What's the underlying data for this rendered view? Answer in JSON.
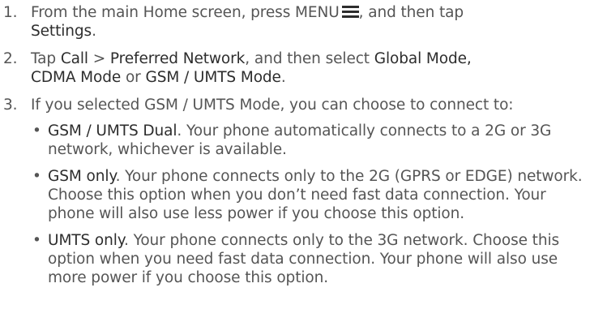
{
  "steps": [
    {
      "number": "1.",
      "part1": "From the main Home screen, press MENU",
      "icon": "menu-icon",
      "part2": ", and then tap",
      "settings": "Settings",
      "part3": "."
    },
    {
      "number": "2.",
      "part1": "Tap",
      "call": "Call",
      "sep": ">",
      "preferred": "Preferred Network",
      "part2": ", and then select",
      "global": "Global Mode,",
      "cdma": "CDMA Mode",
      "or": "or",
      "gsm_umts": "GSM / UMTS Mode",
      "part3": "."
    },
    {
      "number": "3.",
      "text": "If you selected GSM / UMTS Mode, you can choose to connect to:",
      "bullets": [
        {
          "title": "GSM / UMTS Dual",
          "text": ". Your phone automatically connects to a 2G or 3G network, whichever is available."
        },
        {
          "title": "GSM only",
          "text": ". Your phone connects only to the 2G (GPRS or EDGE) network. Choose this option when you don’t need fast data connection. Your phone will also use less power if you choose this option."
        },
        {
          "title": "UMTS only",
          "text": ". Your phone connects only to the 3G network. Choose this option when you need fast data connection. Your phone will also use more power if you choose this option."
        }
      ]
    }
  ],
  "bullet_glyph": "•"
}
